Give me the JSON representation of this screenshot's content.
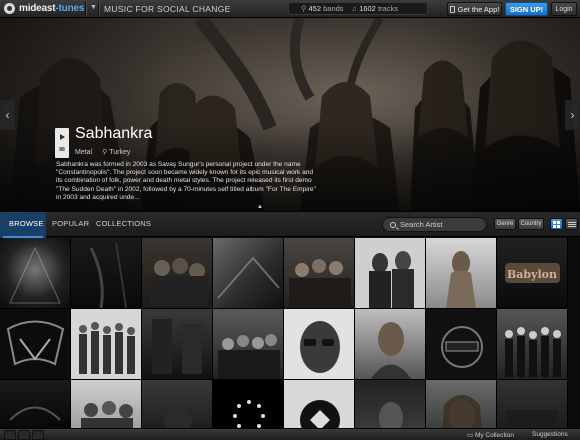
{
  "app": {
    "logo_main": "mideast",
    "logo_accent": "-tunes",
    "tagline": "MUSIC FOR SOCIAL CHANGE"
  },
  "stats": {
    "bands_count": "452",
    "bands_label": "bands",
    "tracks_count": "1602",
    "tracks_label": "tracks"
  },
  "header_buttons": {
    "get_app": "Get the App!",
    "sign_up": "SIGN UP!",
    "login": "Login"
  },
  "featured": {
    "name": "Sabhankra",
    "genre": "Metal",
    "country": "Turkey",
    "tile_number": "88",
    "bio": "Sabhankra was formed in 2003 as Savaş Sungur's personal project under the name \"Constantinopolis\". The project soon became widely known for its epic musical work and its combination of folk, power and death metal styles. The project released its first demo \"The Sudden Death\" in 2002, followed by a 70-minutes self titled album \"For The Empire\" in 2003 and acquired unde..."
  },
  "browse": {
    "tabs": [
      "BROWSE",
      "POPULAR",
      "COLLECTIONS"
    ],
    "active_tab": "BROWSE",
    "search_placeholder": "Search Artist",
    "sort_genre": "Genre",
    "sort_country": "Country"
  },
  "bottom": {
    "my_collection": "My Collection",
    "suggestions": "Suggestions"
  }
}
